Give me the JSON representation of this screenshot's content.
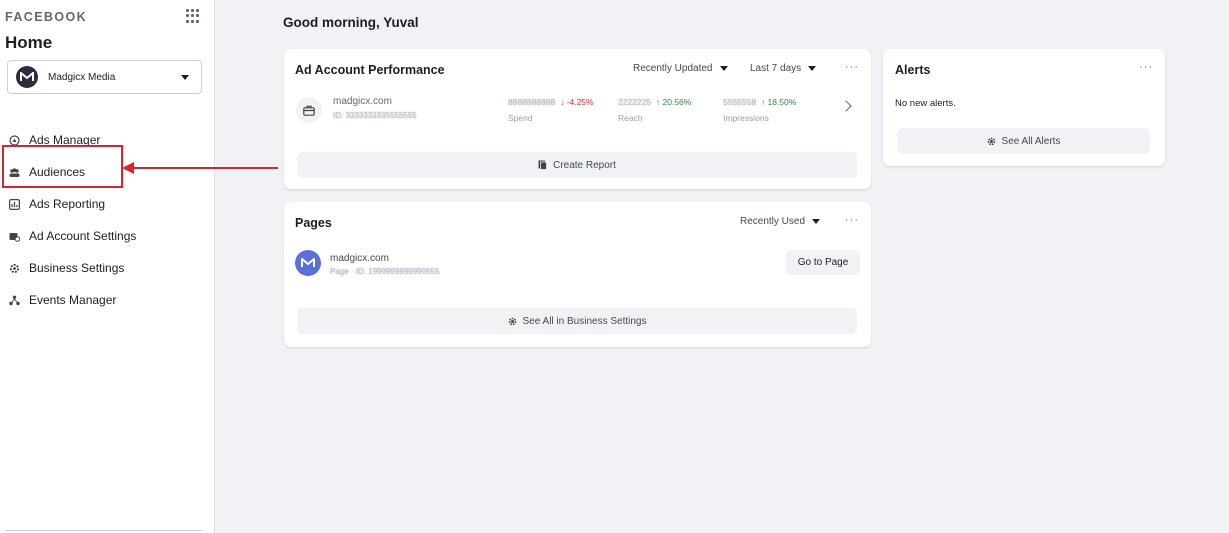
{
  "sidebar": {
    "brand": "FACEBOOK",
    "title": "Home",
    "account": {
      "name": "Madgicx Media"
    },
    "nav": [
      {
        "label": "Ads Manager",
        "icon": "ads-manager-icon"
      },
      {
        "label": "Audiences",
        "icon": "audiences-icon"
      },
      {
        "label": "Ads Reporting",
        "icon": "ads-reporting-icon"
      },
      {
        "label": "Ad Account Settings",
        "icon": "ad-account-settings-icon"
      },
      {
        "label": "Business Settings",
        "icon": "business-settings-icon"
      },
      {
        "label": "Events Manager",
        "icon": "events-manager-icon"
      }
    ]
  },
  "greeting": "Good morning, Yuval",
  "ad_performance": {
    "title": "Ad Account Performance",
    "sort_label": "Recently Updated",
    "range_label": "Last 7 days",
    "more": "···",
    "account": {
      "name": "madgicx.com",
      "id": "ID: 3333333335555555"
    },
    "stats": [
      {
        "value": "8888888888",
        "change": "-4.25%",
        "direction": "down",
        "label": "Spend"
      },
      {
        "value": "2222225",
        "change": "20.56%",
        "direction": "up",
        "label": "Reach"
      },
      {
        "value": "5555558",
        "change": "18.50%",
        "direction": "up",
        "label": "Impressions"
      }
    ],
    "create_report_label": "Create Report"
  },
  "pages": {
    "title": "Pages",
    "sort_label": "Recently Used",
    "more": "···",
    "page": {
      "name": "madgicx.com",
      "meta": "Page · ID: 1999999999999555"
    },
    "goto_label": "Go to Page",
    "see_all_label": "See All in Business Settings"
  },
  "alerts": {
    "title": "Alerts",
    "more": "···",
    "empty_text": "No new alerts.",
    "see_all_label": "See All Alerts"
  },
  "colors": {
    "highlight": "#d9232d",
    "up": "#2e8b3e",
    "down": "#e02a2a",
    "page_avatar": "#5b6fd9"
  }
}
